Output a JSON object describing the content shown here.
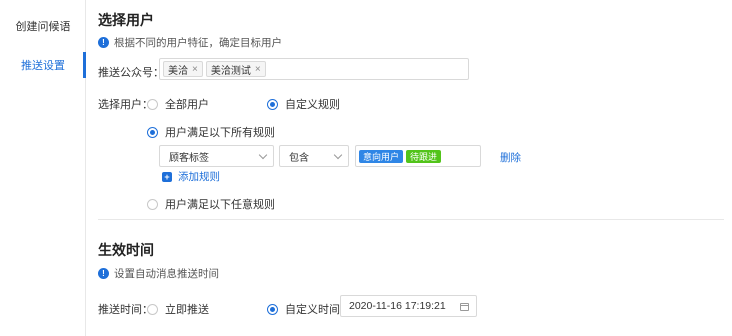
{
  "sidebar": {
    "items": [
      {
        "label": "创建问候语"
      },
      {
        "label": "推送设置"
      }
    ]
  },
  "select_users": {
    "title": "选择用户",
    "hint": "根据不同的用户特征，确定目标用户",
    "account_label": "推送公众号：",
    "accounts": [
      "美洽",
      "美洽测试"
    ],
    "users_label": "选择用户：",
    "option_all": "全部用户",
    "option_custom": "自定义规则",
    "match_all": "用户满足以下所有规则",
    "match_any": "用户满足以下任意规则",
    "rule": {
      "field": "顾客标签",
      "operator": "包含",
      "values": [
        "意向用户",
        "待跟进"
      ],
      "delete_label": "删除"
    },
    "add_rule_label": "添加规则"
  },
  "effective_time": {
    "title": "生效时间",
    "hint": "设置自动消息推送时间",
    "push_label": "推送时间：",
    "option_now": "立即推送",
    "option_custom": "自定义时间",
    "datetime": "2020-11-16 17:19:21"
  },
  "colors": {
    "accent": "#1e6fd9",
    "chip_blue": "#2f86e6",
    "chip_green": "#52c41a"
  },
  "icons": [
    "info-icon",
    "close-icon",
    "chevron-down-icon",
    "plus-icon",
    "calendar-icon"
  ]
}
